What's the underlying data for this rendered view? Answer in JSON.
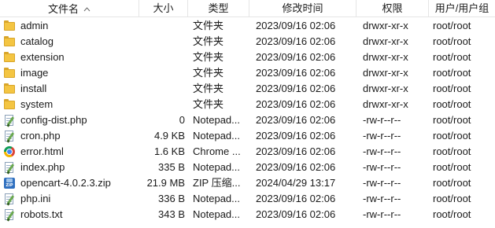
{
  "columns": {
    "name": "文件名",
    "size": "大小",
    "type": "类型",
    "modified": "修改时间",
    "permissions": "权限",
    "owner": "用户/用户组"
  },
  "sort": {
    "column": "name",
    "direction": "ascending",
    "icon": "sort-up-chevron-icon"
  },
  "colors": {
    "folder": "#f4c542",
    "header_border": "#e5e5e5",
    "zip": "#2f6fbf"
  },
  "files": [
    {
      "name": "admin",
      "size": "",
      "type": "文件夹",
      "modified": "2023/09/16 02:06",
      "perm": "drwxr-xr-x",
      "owner": "root/root",
      "icon": "folder"
    },
    {
      "name": "catalog",
      "size": "",
      "type": "文件夹",
      "modified": "2023/09/16 02:06",
      "perm": "drwxr-xr-x",
      "owner": "root/root",
      "icon": "folder"
    },
    {
      "name": "extension",
      "size": "",
      "type": "文件夹",
      "modified": "2023/09/16 02:06",
      "perm": "drwxr-xr-x",
      "owner": "root/root",
      "icon": "folder"
    },
    {
      "name": "image",
      "size": "",
      "type": "文件夹",
      "modified": "2023/09/16 02:06",
      "perm": "drwxr-xr-x",
      "owner": "root/root",
      "icon": "folder"
    },
    {
      "name": "install",
      "size": "",
      "type": "文件夹",
      "modified": "2023/09/16 02:06",
      "perm": "drwxr-xr-x",
      "owner": "root/root",
      "icon": "folder"
    },
    {
      "name": "system",
      "size": "",
      "type": "文件夹",
      "modified": "2023/09/16 02:06",
      "perm": "drwxr-xr-x",
      "owner": "root/root",
      "icon": "folder"
    },
    {
      "name": "config-dist.php",
      "size": "0",
      "type": "Notepad...",
      "modified": "2023/09/16 02:06",
      "perm": "-rw-r--r--",
      "owner": "root/root",
      "icon": "notepad"
    },
    {
      "name": "cron.php",
      "size": "4.9 KB",
      "type": "Notepad...",
      "modified": "2023/09/16 02:06",
      "perm": "-rw-r--r--",
      "owner": "root/root",
      "icon": "notepad"
    },
    {
      "name": "error.html",
      "size": "1.6 KB",
      "type": "Chrome ...",
      "modified": "2023/09/16 02:06",
      "perm": "-rw-r--r--",
      "owner": "root/root",
      "icon": "chrome"
    },
    {
      "name": "index.php",
      "size": "335 B",
      "type": "Notepad...",
      "modified": "2023/09/16 02:06",
      "perm": "-rw-r--r--",
      "owner": "root/root",
      "icon": "notepad"
    },
    {
      "name": "opencart-4.0.2.3.zip",
      "size": "21.9 MB",
      "type": "ZIP 压缩...",
      "modified": "2024/04/29 13:17",
      "perm": "-rw-r--r--",
      "owner": "root/root",
      "icon": "zip",
      "icon_text": "ZIP"
    },
    {
      "name": "php.ini",
      "size": "336 B",
      "type": "Notepad...",
      "modified": "2023/09/16 02:06",
      "perm": "-rw-r--r--",
      "owner": "root/root",
      "icon": "notepad"
    },
    {
      "name": "robots.txt",
      "size": "343 B",
      "type": "Notepad...",
      "modified": "2023/09/16 02:06",
      "perm": "-rw-r--r--",
      "owner": "root/root",
      "icon": "notepad"
    }
  ]
}
